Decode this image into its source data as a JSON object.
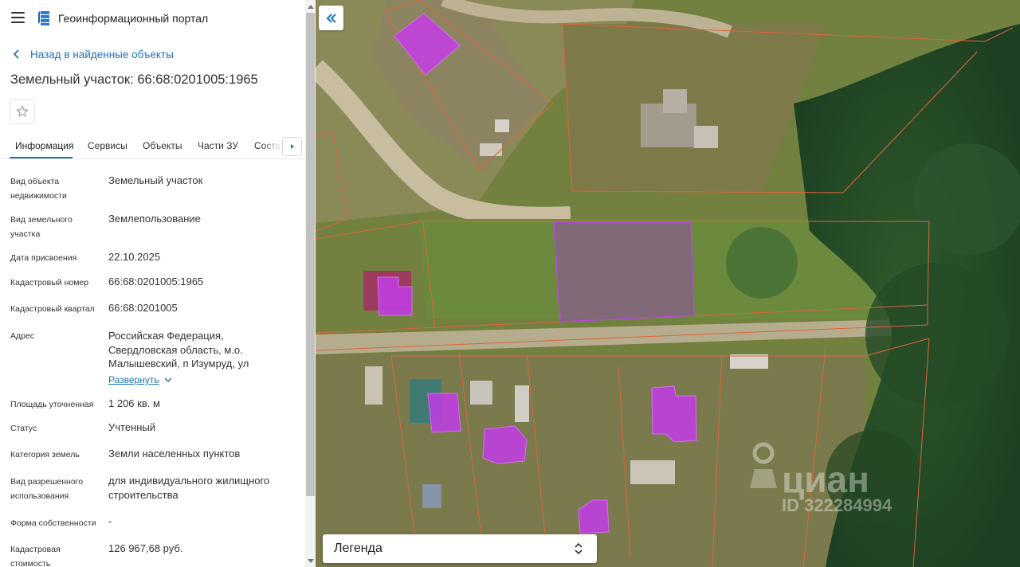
{
  "header": {
    "title": "Геоинформационный портал"
  },
  "nav": {
    "back_label": "Назад в найденные объекты"
  },
  "page": {
    "title": "Земельный участок: 66:68:0201005:1965"
  },
  "tabs": [
    {
      "label": "Информация",
      "active": true
    },
    {
      "label": "Сервисы"
    },
    {
      "label": "Объекты"
    },
    {
      "label": "Части ЗУ"
    },
    {
      "label": "Состав"
    }
  ],
  "info": {
    "object_type": {
      "label": "Вид объекта недвижимости",
      "value": "Земельный участок"
    },
    "land_type": {
      "label": "Вид земельного участка",
      "value": "Землепользование"
    },
    "assigned_date": {
      "label": "Дата присвоения",
      "value": "22.10.2025"
    },
    "cadastral_number": {
      "label": "Кадастровый номер",
      "value": "66:68:0201005:1965"
    },
    "cadastral_quarter": {
      "label": "Кадастровый квартал",
      "value": "66:68:0201005"
    },
    "address": {
      "label": "Адрес",
      "value": "Российская Федерация, Свердловская область, м.о. Малышевский, п Изумруд, ул",
      "expand_label": "Развернуть"
    },
    "area": {
      "label": "Площадь уточненная",
      "value": "1 206 кв. м"
    },
    "status": {
      "label": "Статус",
      "value": "Учтенный"
    },
    "land_category": {
      "label": "Категория земель",
      "value": "Земли населенных пунктов"
    },
    "permitted_use": {
      "label": "Вид разрешенного использования",
      "value": "для индивидуального жилищного строительства"
    },
    "ownership": {
      "label": "Форма собственности",
      "value": "-"
    },
    "cadastral_value": {
      "label": "Кадастровая стоимость",
      "value": "126 967,68 руб."
    }
  },
  "map": {
    "legend_label": "Легенда",
    "watermark_brand": "циан",
    "watermark_id": "ID 322284994",
    "parcel_border_color": "#e0643c",
    "selected_fill_color": "#a03cc8",
    "building_fill_color": "#c33ce6"
  },
  "colors": {
    "accent": "#1f73b7"
  },
  "icons": [
    "menu-icon",
    "portal-logo-icon",
    "chevron-left-icon",
    "star-icon",
    "chevron-right-icon",
    "double-chevron-left-icon",
    "chevron-down-icon",
    "sort-arrows-icon"
  ]
}
